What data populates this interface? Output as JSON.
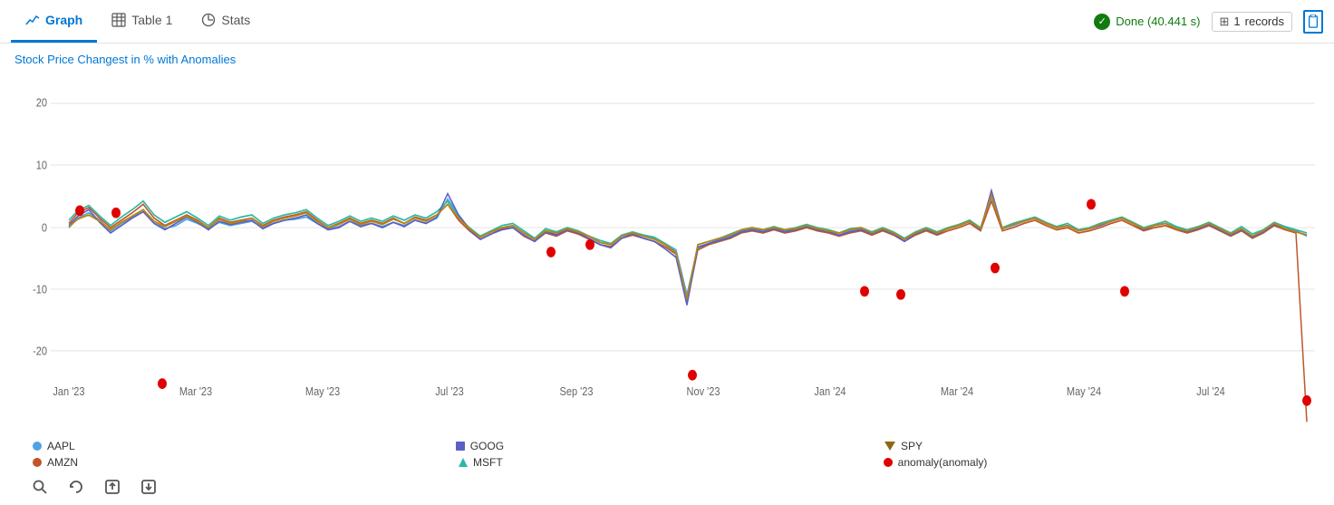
{
  "tabs": [
    {
      "id": "graph",
      "label": "Graph",
      "icon": "chart-icon",
      "active": true
    },
    {
      "id": "table1",
      "label": "Table 1",
      "icon": "table-icon",
      "active": false
    },
    {
      "id": "stats",
      "label": "Stats",
      "icon": "stats-icon",
      "active": false
    }
  ],
  "status": {
    "done_label": "Done (40.441 s)",
    "records_count": "1",
    "records_label": "records"
  },
  "chart": {
    "title": "Stock Price Changest in % with Anomalies",
    "y_axis": {
      "max": 20,
      "mid_upper": 10,
      "zero": 0,
      "mid_lower": -10,
      "min": -20
    },
    "x_axis_labels": [
      "Jan '23",
      "Mar '23",
      "May '23",
      "Jul '23",
      "Sep '23",
      "Nov '23",
      "Jan '24",
      "Mar '24",
      "May '24",
      "Jul '24"
    ]
  },
  "legend": [
    {
      "id": "aapl",
      "label": "AAPL",
      "color": "#4fa3e0",
      "shape": "dot"
    },
    {
      "id": "amzn",
      "label": "AMZN",
      "color": "#c0562a",
      "shape": "dot"
    },
    {
      "id": "goog",
      "label": "GOOG",
      "color": "#5b5fc7",
      "shape": "square"
    },
    {
      "id": "msft",
      "label": "MSFT",
      "color": "#2db8a5",
      "shape": "triangle-up"
    },
    {
      "id": "spy",
      "label": "SPY",
      "color": "#8B6914",
      "shape": "triangle-down"
    },
    {
      "id": "anomaly",
      "label": "anomaly(anomaly)",
      "color": "#e00000",
      "shape": "dot"
    }
  ],
  "toolbar": {
    "search_title": "Search",
    "refresh_title": "Refresh",
    "export_title": "Export",
    "download_title": "Download"
  }
}
